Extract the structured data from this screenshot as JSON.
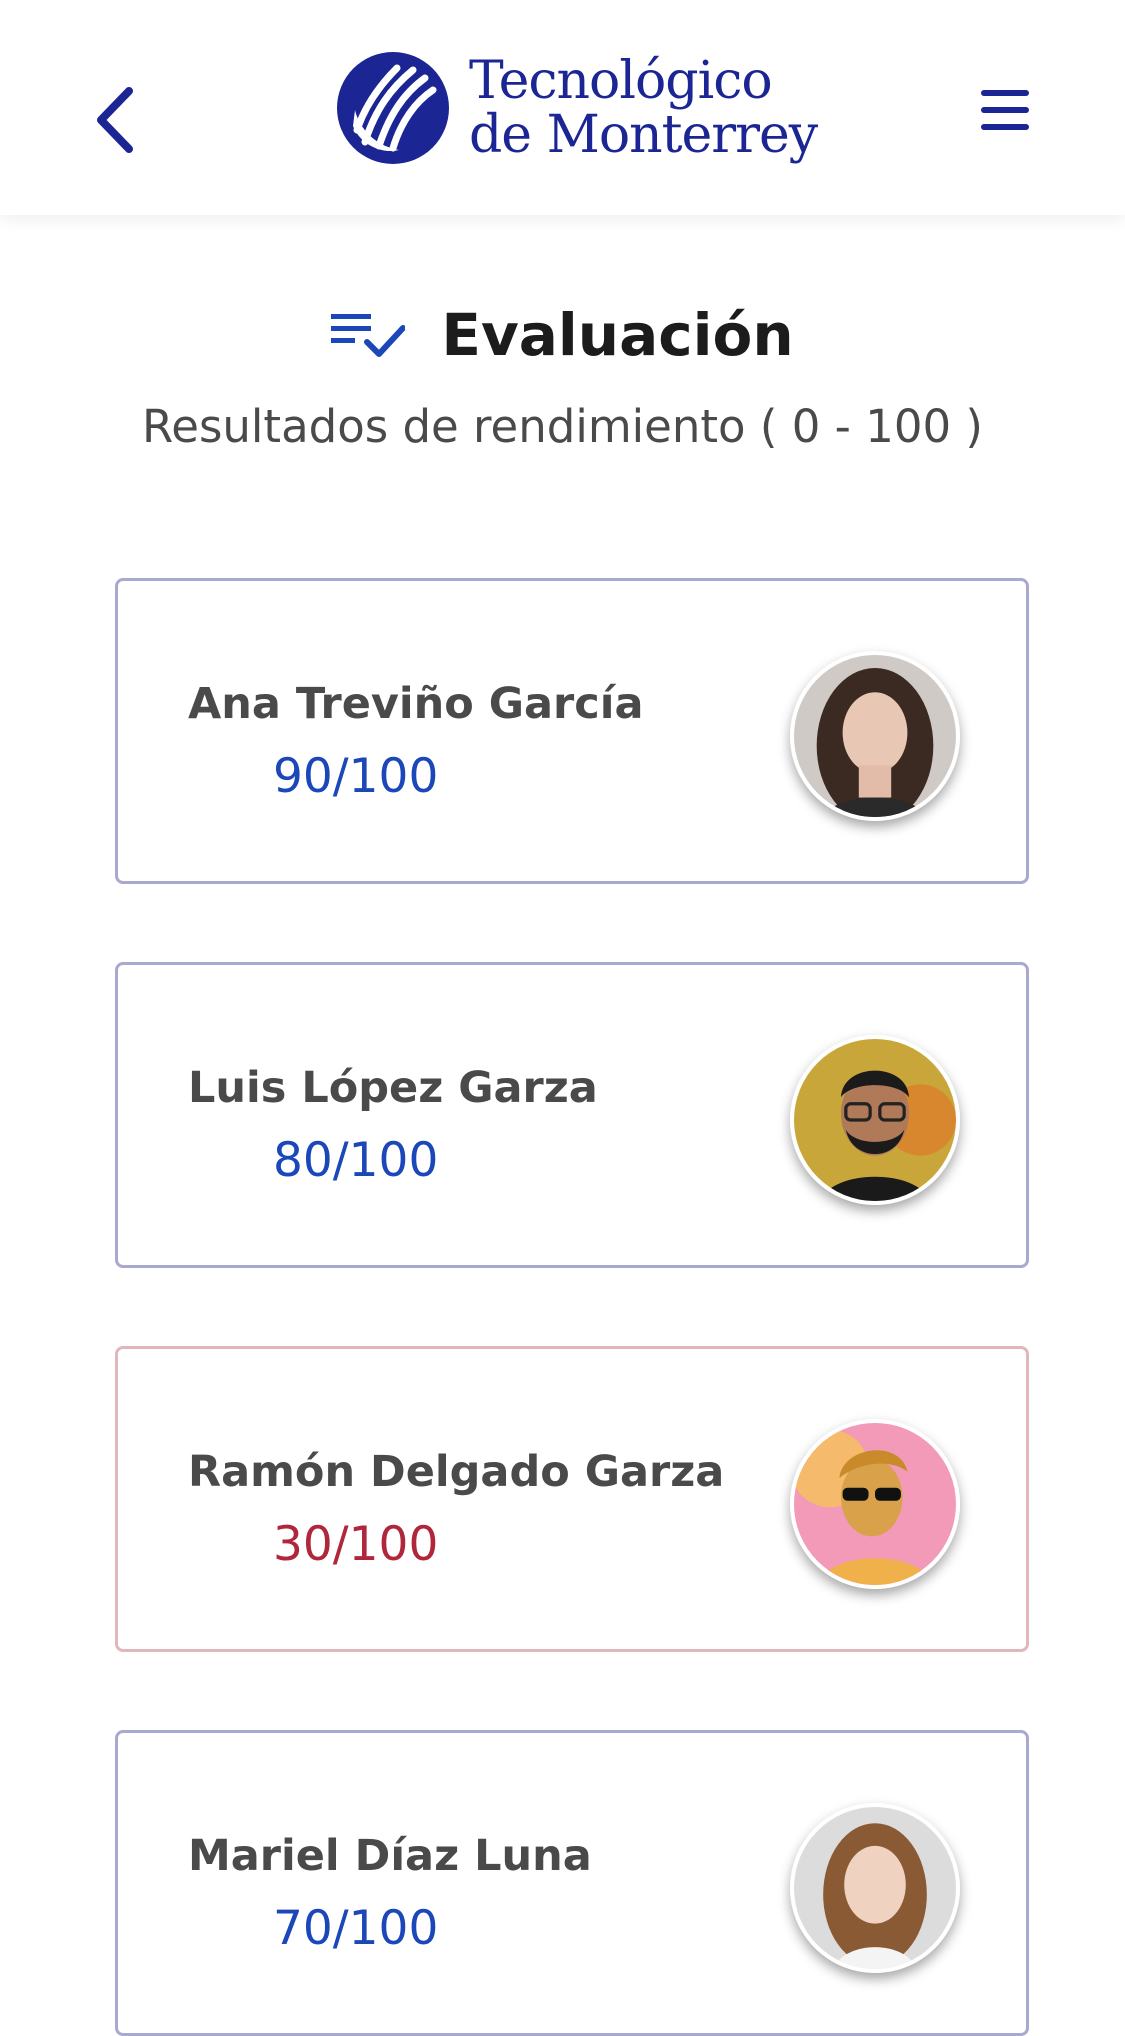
{
  "header": {
    "logo_line1": "Tecnológico",
    "logo_line2": "de Monterrey",
    "back_icon": "chevron-left-icon",
    "menu_icon": "hamburger-menu-icon",
    "brand_color": "#1b2593"
  },
  "page": {
    "title": "Evaluación",
    "title_icon": "playlist-check-icon",
    "subtitle": "Resultados de rendimiento ( 0 - 100 )"
  },
  "results": [
    {
      "name": "Ana Treviño García",
      "score": "90/100",
      "status": "normal"
    },
    {
      "name": "Luis López Garza",
      "score": "80/100",
      "status": "normal"
    },
    {
      "name": "Ramón Delgado Garza",
      "score": "30/100",
      "status": "low"
    },
    {
      "name": "Mariel Díaz Luna",
      "score": "70/100",
      "status": "normal"
    }
  ],
  "colors": {
    "score_normal": "#1b47b8",
    "score_low": "#b0263a",
    "border_normal": "#a9a8cf",
    "border_low": "#e2b6bd"
  }
}
